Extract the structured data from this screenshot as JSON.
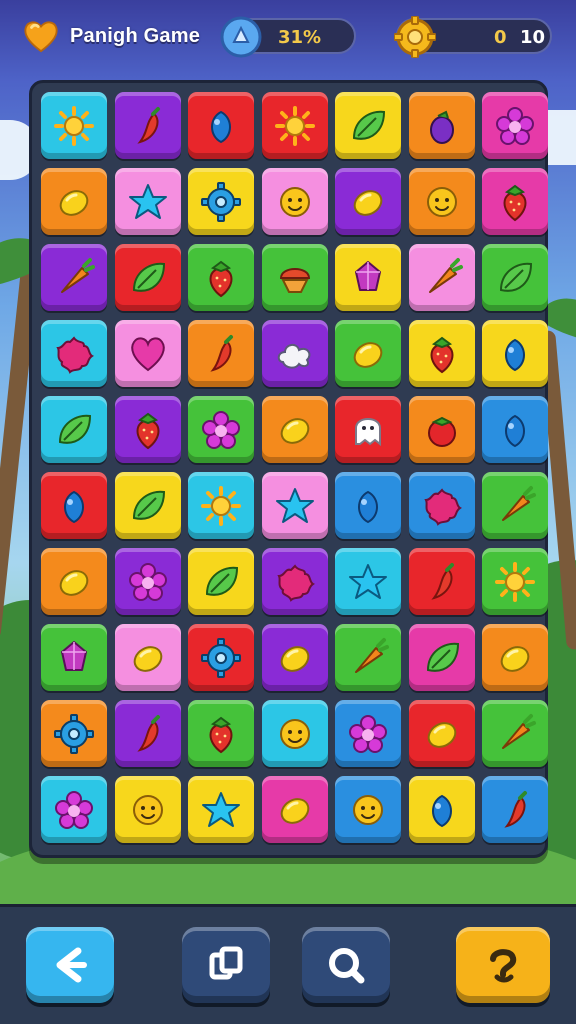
{
  "hud": {
    "title": "Panigh Game",
    "progress_text": "31%",
    "coins_left": "0",
    "coins_right": "10"
  },
  "colors": {
    "cyan": "#2cc6e6",
    "purple": "#8a2bd6",
    "red": "#e8262b",
    "yellow": "#f7d71c",
    "orange": "#f48a1c",
    "magenta": "#e63aa8",
    "pink": "#f58fe0",
    "green": "#45c23a",
    "blue": "#2a8fe0"
  },
  "board": {
    "rows": [
      [
        {
          "color": "cyan",
          "icon": "sun"
        },
        {
          "color": "purple",
          "icon": "chili"
        },
        {
          "color": "red",
          "icon": "berry"
        },
        {
          "color": "red",
          "icon": "sun"
        },
        {
          "color": "yellow",
          "icon": "leaf"
        },
        {
          "color": "orange",
          "icon": "eggplant"
        },
        {
          "color": "magenta",
          "icon": "flower"
        }
      ],
      [
        {
          "color": "orange",
          "icon": "lemon"
        },
        {
          "color": "pink",
          "icon": "star"
        },
        {
          "color": "yellow",
          "icon": "gear"
        },
        {
          "color": "pink",
          "icon": "face"
        },
        {
          "color": "purple",
          "icon": "lemon"
        },
        {
          "color": "orange",
          "icon": "face"
        },
        {
          "color": "magenta",
          "icon": "strawberry"
        }
      ],
      [
        {
          "color": "purple",
          "icon": "carrot"
        },
        {
          "color": "red",
          "icon": "leaf"
        },
        {
          "color": "green",
          "icon": "strawberry"
        },
        {
          "color": "green",
          "icon": "nut"
        },
        {
          "color": "yellow",
          "icon": "gem"
        },
        {
          "color": "pink",
          "icon": "carrot"
        },
        {
          "color": "green",
          "icon": "leaf"
        }
      ],
      [
        {
          "color": "cyan",
          "icon": "splat"
        },
        {
          "color": "pink",
          "icon": "heart"
        },
        {
          "color": "orange",
          "icon": "chili"
        },
        {
          "color": "purple",
          "icon": "cloud"
        },
        {
          "color": "green",
          "icon": "lemon"
        },
        {
          "color": "yellow",
          "icon": "strawberry"
        },
        {
          "color": "yellow",
          "icon": "berry"
        }
      ],
      [
        {
          "color": "cyan",
          "icon": "leaf"
        },
        {
          "color": "purple",
          "icon": "strawberry"
        },
        {
          "color": "green",
          "icon": "flower"
        },
        {
          "color": "orange",
          "icon": "lemon"
        },
        {
          "color": "red",
          "icon": "ghost"
        },
        {
          "color": "orange",
          "icon": "tomato"
        },
        {
          "color": "blue",
          "icon": "berry"
        }
      ],
      [
        {
          "color": "red",
          "icon": "berry"
        },
        {
          "color": "yellow",
          "icon": "leaf"
        },
        {
          "color": "cyan",
          "icon": "sun"
        },
        {
          "color": "pink",
          "icon": "star"
        },
        {
          "color": "blue",
          "icon": "berry"
        },
        {
          "color": "blue",
          "icon": "splat"
        },
        {
          "color": "green",
          "icon": "carrot"
        }
      ],
      [
        {
          "color": "orange",
          "icon": "lemon"
        },
        {
          "color": "purple",
          "icon": "flower"
        },
        {
          "color": "yellow",
          "icon": "leaf"
        },
        {
          "color": "purple",
          "icon": "splat"
        },
        {
          "color": "cyan",
          "icon": "star"
        },
        {
          "color": "red",
          "icon": "chili"
        },
        {
          "color": "green",
          "icon": "sun"
        }
      ],
      [
        {
          "color": "green",
          "icon": "gem"
        },
        {
          "color": "pink",
          "icon": "lemon"
        },
        {
          "color": "red",
          "icon": "gear"
        },
        {
          "color": "purple",
          "icon": "lemon"
        },
        {
          "color": "green",
          "icon": "carrot"
        },
        {
          "color": "magenta",
          "icon": "leaf"
        },
        {
          "color": "orange",
          "icon": "lemon"
        }
      ],
      [
        {
          "color": "orange",
          "icon": "gear"
        },
        {
          "color": "purple",
          "icon": "chili"
        },
        {
          "color": "green",
          "icon": "strawberry"
        },
        {
          "color": "cyan",
          "icon": "face"
        },
        {
          "color": "blue",
          "icon": "flower"
        },
        {
          "color": "red",
          "icon": "lemon"
        },
        {
          "color": "green",
          "icon": "carrot"
        }
      ],
      [
        {
          "color": "cyan",
          "icon": "flower"
        },
        {
          "color": "yellow",
          "icon": "face"
        },
        {
          "color": "yellow",
          "icon": "star"
        },
        {
          "color": "magenta",
          "icon": "lemon"
        },
        {
          "color": "blue",
          "icon": "face"
        },
        {
          "color": "yellow",
          "icon": "berry"
        },
        {
          "color": "blue",
          "icon": "chili"
        }
      ]
    ]
  },
  "bottom_bar": {
    "buttons": [
      {
        "name": "back-button",
        "icon": "arrow-left-icon"
      },
      {
        "name": "shuffle-button",
        "icon": "shuffle-icon"
      },
      {
        "name": "search-button",
        "icon": "search-icon"
      },
      {
        "name": "hint-button",
        "icon": "hint-icon"
      }
    ]
  }
}
